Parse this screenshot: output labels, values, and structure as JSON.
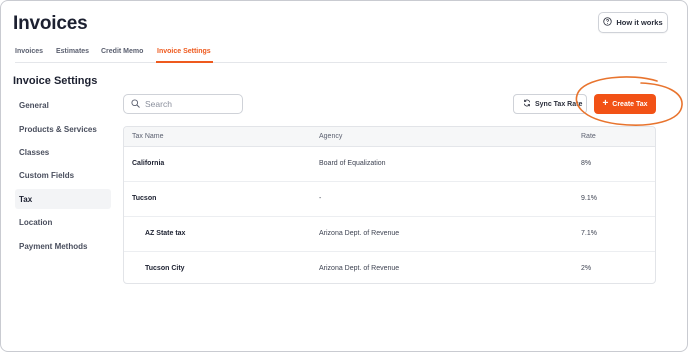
{
  "page": {
    "title": "Invoices",
    "help_button": "How it works"
  },
  "tabs": [
    {
      "label": "Invoices"
    },
    {
      "label": "Estimates"
    },
    {
      "label": "Credit Memo"
    },
    {
      "label": "Invoice Settings",
      "active": true
    }
  ],
  "settings": {
    "title": "Invoice Settings",
    "sidebar": [
      {
        "label": "General"
      },
      {
        "label": "Products & Services"
      },
      {
        "label": "Classes"
      },
      {
        "label": "Custom Fields"
      },
      {
        "label": "Tax",
        "active": true
      },
      {
        "label": "Location"
      },
      {
        "label": "Payment Methods"
      }
    ]
  },
  "toolbar": {
    "search_placeholder": "Search",
    "search_value": "",
    "sync_label": "Sync Tax Rate",
    "create_label": "Create Tax"
  },
  "table": {
    "columns": [
      "Tax Name",
      "Agency",
      "Rate"
    ],
    "rows": [
      {
        "name": "California",
        "agency": "Board of Equalization",
        "rate": "8%",
        "indent": false
      },
      {
        "name": "Tucson",
        "agency": "-",
        "rate": "9.1%",
        "indent": false
      },
      {
        "name": "AZ State tax",
        "agency": "Arizona Dept. of Revenue",
        "rate": "7.1%",
        "indent": true
      },
      {
        "name": "Tucson City",
        "agency": "Arizona Dept. of Revenue",
        "rate": "2%",
        "indent": true
      }
    ]
  },
  "colors": {
    "accent": "#f25216",
    "annotation": "#e8742e"
  },
  "icons": {
    "help": "question-circle-icon",
    "search": "search-icon",
    "sync": "sync-icon",
    "create": "plus-icon"
  }
}
